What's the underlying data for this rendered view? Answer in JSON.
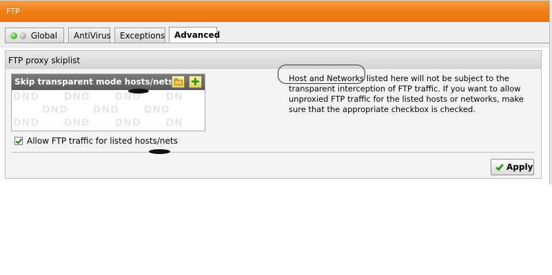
{
  "titlebar": {
    "title": "FTP"
  },
  "tabs": [
    {
      "label": "Global"
    },
    {
      "label": "AntiVirus"
    },
    {
      "label": "Exceptions"
    },
    {
      "label": "Advanced"
    }
  ],
  "panel": {
    "title": "FTP proxy skiplist",
    "listbox": {
      "title": "Skip transparent mode hosts/nets",
      "watermark_row1": "DND DND DND DN",
      "watermark_row2": "DND DND DND",
      "watermark_row3": "DND DND DND DN"
    },
    "checkbox": {
      "label": "Allow FTP traffic for listed hosts/nets",
      "checked": true
    },
    "help_text": "Host and Networks listed here will not be subject to the transparent interception of FTP traffic. If you want to allow unproxied FTP traffic for the listed hosts or networks, make sure that the appropriate checkbox is checked.",
    "apply_label": "Apply"
  },
  "icons": {
    "folder": "folder-icon",
    "add": "add-icon",
    "status_green": "status-green-icon",
    "status_gray": "status-gray-icon"
  },
  "colors": {
    "titlebar": "#f07d12",
    "list_header": "#6a6a6a",
    "accent_green": "#2f9b1c"
  }
}
